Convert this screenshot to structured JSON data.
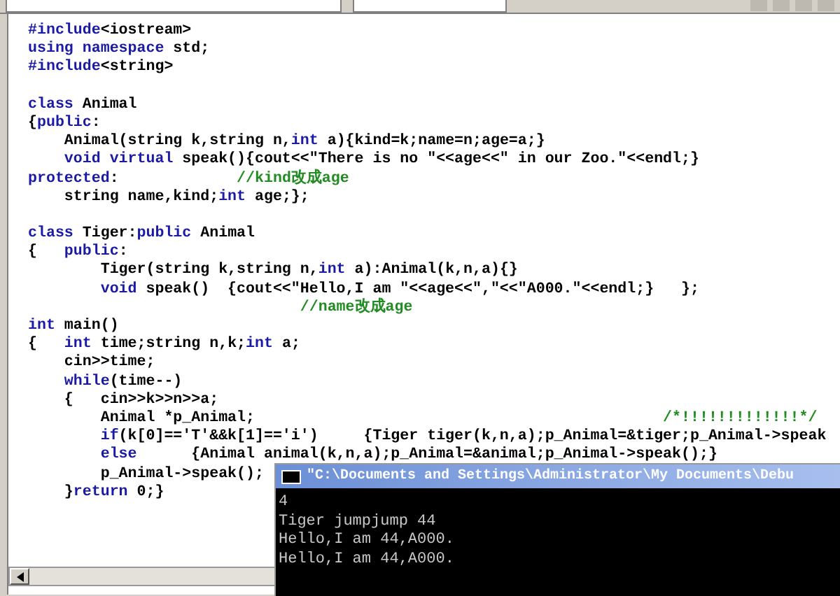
{
  "editor": {
    "blocks": [
      [
        {
          "segments": [
            {
              "kind": "keyword",
              "text": "#include"
            },
            {
              "kind": "plain",
              "text": "<iostream>"
            }
          ]
        },
        {
          "segments": [
            {
              "kind": "keyword",
              "text": "using namespace"
            },
            {
              "kind": "plain",
              "text": " std;"
            }
          ]
        },
        {
          "segments": [
            {
              "kind": "keyword",
              "text": "#include"
            },
            {
              "kind": "plain",
              "text": "<string>"
            }
          ]
        }
      ],
      [
        {
          "segments": [
            {
              "kind": "keyword",
              "text": "class"
            },
            {
              "kind": "plain",
              "text": " Animal"
            }
          ]
        },
        {
          "segments": [
            {
              "kind": "plain",
              "text": "{"
            },
            {
              "kind": "keyword",
              "text": "public"
            },
            {
              "kind": "plain",
              "text": ":"
            }
          ]
        },
        {
          "segments": [
            {
              "kind": "plain",
              "text": "    Animal(string k,string n,"
            },
            {
              "kind": "keyword",
              "text": "int"
            },
            {
              "kind": "plain",
              "text": " a){kind=k;name=n;age=a;}"
            }
          ]
        },
        {
          "segments": [
            {
              "kind": "keyword",
              "text": "    void virtual"
            },
            {
              "kind": "plain",
              "text": " speak(){cout<<\"There is no \"<<age<<\" in our Zoo.\"<<endl;}"
            }
          ]
        },
        {
          "segments": [
            {
              "kind": "keyword",
              "text": "protected"
            },
            {
              "kind": "plain",
              "text": ":             "
            },
            {
              "kind": "comment",
              "text": "//kind改成age"
            }
          ]
        },
        {
          "segments": [
            {
              "kind": "plain",
              "text": "    string name,kind;"
            },
            {
              "kind": "keyword",
              "text": "int"
            },
            {
              "kind": "plain",
              "text": " age;};"
            }
          ]
        }
      ],
      [
        {
          "segments": [
            {
              "kind": "keyword",
              "text": "class"
            },
            {
              "kind": "plain",
              "text": " Tiger:"
            },
            {
              "kind": "keyword",
              "text": "public"
            },
            {
              "kind": "plain",
              "text": " Animal"
            }
          ]
        },
        {
          "segments": [
            {
              "kind": "plain",
              "text": "{   "
            },
            {
              "kind": "keyword",
              "text": "public"
            },
            {
              "kind": "plain",
              "text": ":"
            }
          ]
        },
        {
          "segments": [
            {
              "kind": "plain",
              "text": "        Tiger(string k,string n,"
            },
            {
              "kind": "keyword",
              "text": "int"
            },
            {
              "kind": "plain",
              "text": " a):Animal(k,n,a){}"
            }
          ]
        },
        {
          "segments": [
            {
              "kind": "keyword",
              "text": "        void"
            },
            {
              "kind": "plain",
              "text": " speak()  {cout<<\"Hello,I am \"<<age<<\",\"<<\"A000.\"<<endl;}   };"
            }
          ]
        },
        {
          "segments": [
            {
              "kind": "comment",
              "text": "                              //name改成age"
            }
          ]
        },
        {
          "segments": [
            {
              "kind": "keyword",
              "text": "int"
            },
            {
              "kind": "plain",
              "text": " main()"
            }
          ]
        },
        {
          "segments": [
            {
              "kind": "plain",
              "text": "{   "
            },
            {
              "kind": "keyword",
              "text": "int"
            },
            {
              "kind": "plain",
              "text": " time;string n,k;"
            },
            {
              "kind": "keyword",
              "text": "int"
            },
            {
              "kind": "plain",
              "text": " a;"
            }
          ]
        },
        {
          "segments": [
            {
              "kind": "plain",
              "text": "    cin>>time;"
            }
          ]
        },
        {
          "segments": [
            {
              "kind": "keyword",
              "text": "    while"
            },
            {
              "kind": "plain",
              "text": "(time--)"
            }
          ]
        },
        {
          "segments": [
            {
              "kind": "plain",
              "text": "    {   cin>>k>>n>>a;"
            }
          ]
        },
        {
          "segments": [
            {
              "kind": "plain",
              "text": "        Animal *p_Animal;                                             "
            },
            {
              "kind": "comment",
              "text": "/*!!!!!!!!!!!!!*/"
            }
          ]
        },
        {
          "segments": [
            {
              "kind": "keyword",
              "text": "        if"
            },
            {
              "kind": "plain",
              "text": "(k[0]=='T'&&k[1]=='i')     {Tiger tiger(k,n,a);p_Animal=&tiger;p_Animal->speak"
            }
          ]
        },
        {
          "segments": [
            {
              "kind": "keyword",
              "text": "        else"
            },
            {
              "kind": "plain",
              "text": "      {Animal animal(k,n,a);p_Animal=&animal;p_Animal->speak();}"
            }
          ]
        },
        {
          "segments": [
            {
              "kind": "plain",
              "text": "        p_Animal->speak();"
            }
          ]
        },
        {
          "segments": [
            {
              "kind": "plain",
              "text": "    }"
            },
            {
              "kind": "keyword",
              "text": "return"
            },
            {
              "kind": "plain",
              "text": " 0;}"
            }
          ]
        }
      ]
    ]
  },
  "console": {
    "title": "\"C:\\Documents and Settings\\Administrator\\My Documents\\Debu",
    "lines": [
      "4",
      "Tiger jumpjump 44",
      "Hello,I am 44,A000.",
      "Hello,I am 44,A000."
    ]
  }
}
